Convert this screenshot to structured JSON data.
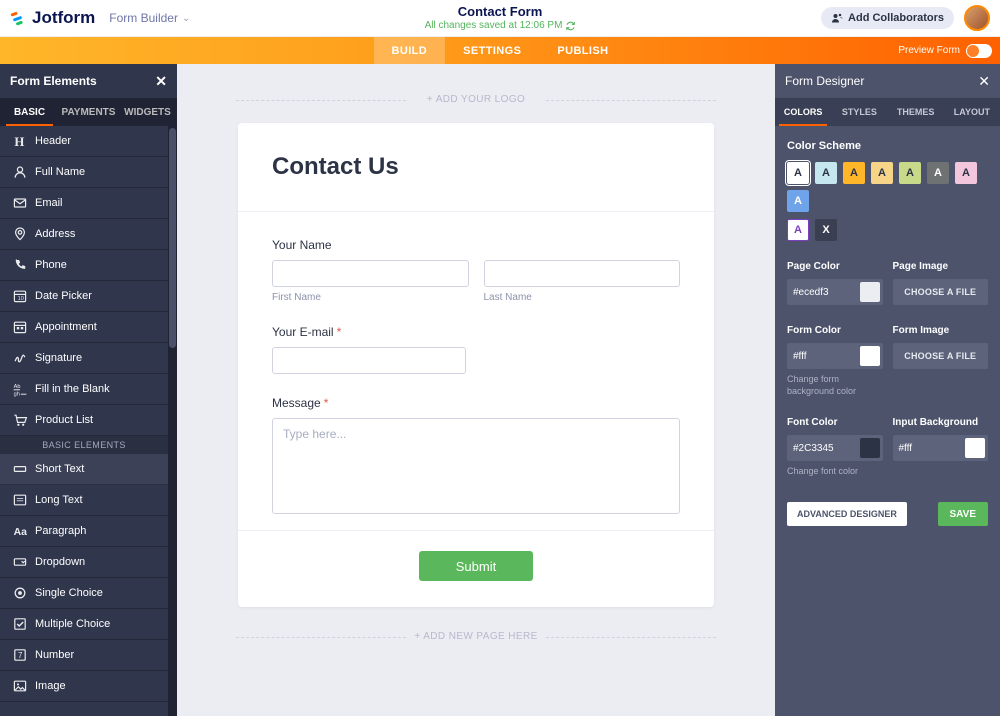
{
  "header": {
    "brand": "Jotform",
    "mode": "Form Builder",
    "form_title": "Contact Form",
    "save_status": "All changes saved at 12:06 PM",
    "collab_label": "Add Collaborators"
  },
  "nav": {
    "tabs": [
      "BUILD",
      "SETTINGS",
      "PUBLISH"
    ],
    "active_index": 0,
    "preview_label": "Preview Form"
  },
  "left_panel": {
    "title": "Form Elements",
    "subtabs": [
      "BASIC",
      "PAYMENTS",
      "WIDGETS"
    ],
    "basic_group_label": "BASIC ELEMENTS",
    "items_top": [
      {
        "icon": "header",
        "label": "Header"
      },
      {
        "icon": "fullname",
        "label": "Full Name"
      },
      {
        "icon": "email",
        "label": "Email"
      },
      {
        "icon": "address",
        "label": "Address"
      },
      {
        "icon": "phone",
        "label": "Phone"
      },
      {
        "icon": "date",
        "label": "Date Picker"
      },
      {
        "icon": "appointment",
        "label": "Appointment"
      },
      {
        "icon": "signature",
        "label": "Signature"
      },
      {
        "icon": "fill",
        "label": "Fill in the Blank"
      },
      {
        "icon": "product",
        "label": "Product List"
      }
    ],
    "items_basic": [
      {
        "icon": "short",
        "label": "Short Text"
      },
      {
        "icon": "long",
        "label": "Long Text"
      },
      {
        "icon": "paragraph",
        "label": "Paragraph"
      },
      {
        "icon": "dropdown",
        "label": "Dropdown"
      },
      {
        "icon": "single",
        "label": "Single Choice"
      },
      {
        "icon": "multiple",
        "label": "Multiple Choice"
      },
      {
        "icon": "number",
        "label": "Number"
      },
      {
        "icon": "image",
        "label": "Image"
      }
    ]
  },
  "canvas": {
    "add_logo": "+ ADD YOUR LOGO",
    "add_page": "+ ADD NEW PAGE HERE",
    "form": {
      "heading": "Contact Us",
      "name_label": "Your Name",
      "first_name_sub": "First Name",
      "last_name_sub": "Last Name",
      "email_label": "Your E-mail",
      "message_label": "Message",
      "message_placeholder": "Type here...",
      "submit_label": "Submit"
    }
  },
  "right_panel": {
    "title": "Form Designer",
    "tabs": [
      "COLORS",
      "STYLES",
      "THEMES",
      "LAYOUT"
    ],
    "color_scheme_label": "Color Scheme",
    "swatch_letter": "A",
    "swatches_row1": [
      {
        "bg": "#ffffff",
        "fg": "#2c3345",
        "selected": true
      },
      {
        "bg": "#c6e6f0",
        "fg": "#2c3345"
      },
      {
        "bg": "#ffb629",
        "fg": "#2c3345"
      },
      {
        "bg": "#f6d488",
        "fg": "#2c3345"
      },
      {
        "bg": "#c8d989",
        "fg": "#2c3345"
      },
      {
        "bg": "#6f7272",
        "fg": "#ffffff"
      },
      {
        "bg": "#f4c6de",
        "fg": "#2c3345"
      },
      {
        "bg": "#6fa4ea",
        "fg": "#ffffff"
      }
    ],
    "swatches_row2": [
      {
        "bg": "#ffffff",
        "fg": "#7a3fbf",
        "border": "#7a3fbf"
      },
      {
        "bg": "#3a3f52",
        "fg": "#ffffff",
        "letter": "X"
      }
    ],
    "page_color": {
      "label": "Page Color",
      "value": "#ecedf3"
    },
    "page_image": {
      "label": "Page Image",
      "btn": "CHOOSE A FILE"
    },
    "form_color": {
      "label": "Form Color",
      "value": "#fff",
      "hint": "Change form background color"
    },
    "form_image": {
      "label": "Form Image",
      "btn": "CHOOSE A FILE"
    },
    "font_color": {
      "label": "Font Color",
      "value": "#2C3345",
      "hint": "Change font color"
    },
    "input_bg": {
      "label": "Input Background",
      "value": "#fff"
    },
    "advanced_btn": "ADVANCED DESIGNER",
    "save_btn": "SAVE"
  }
}
